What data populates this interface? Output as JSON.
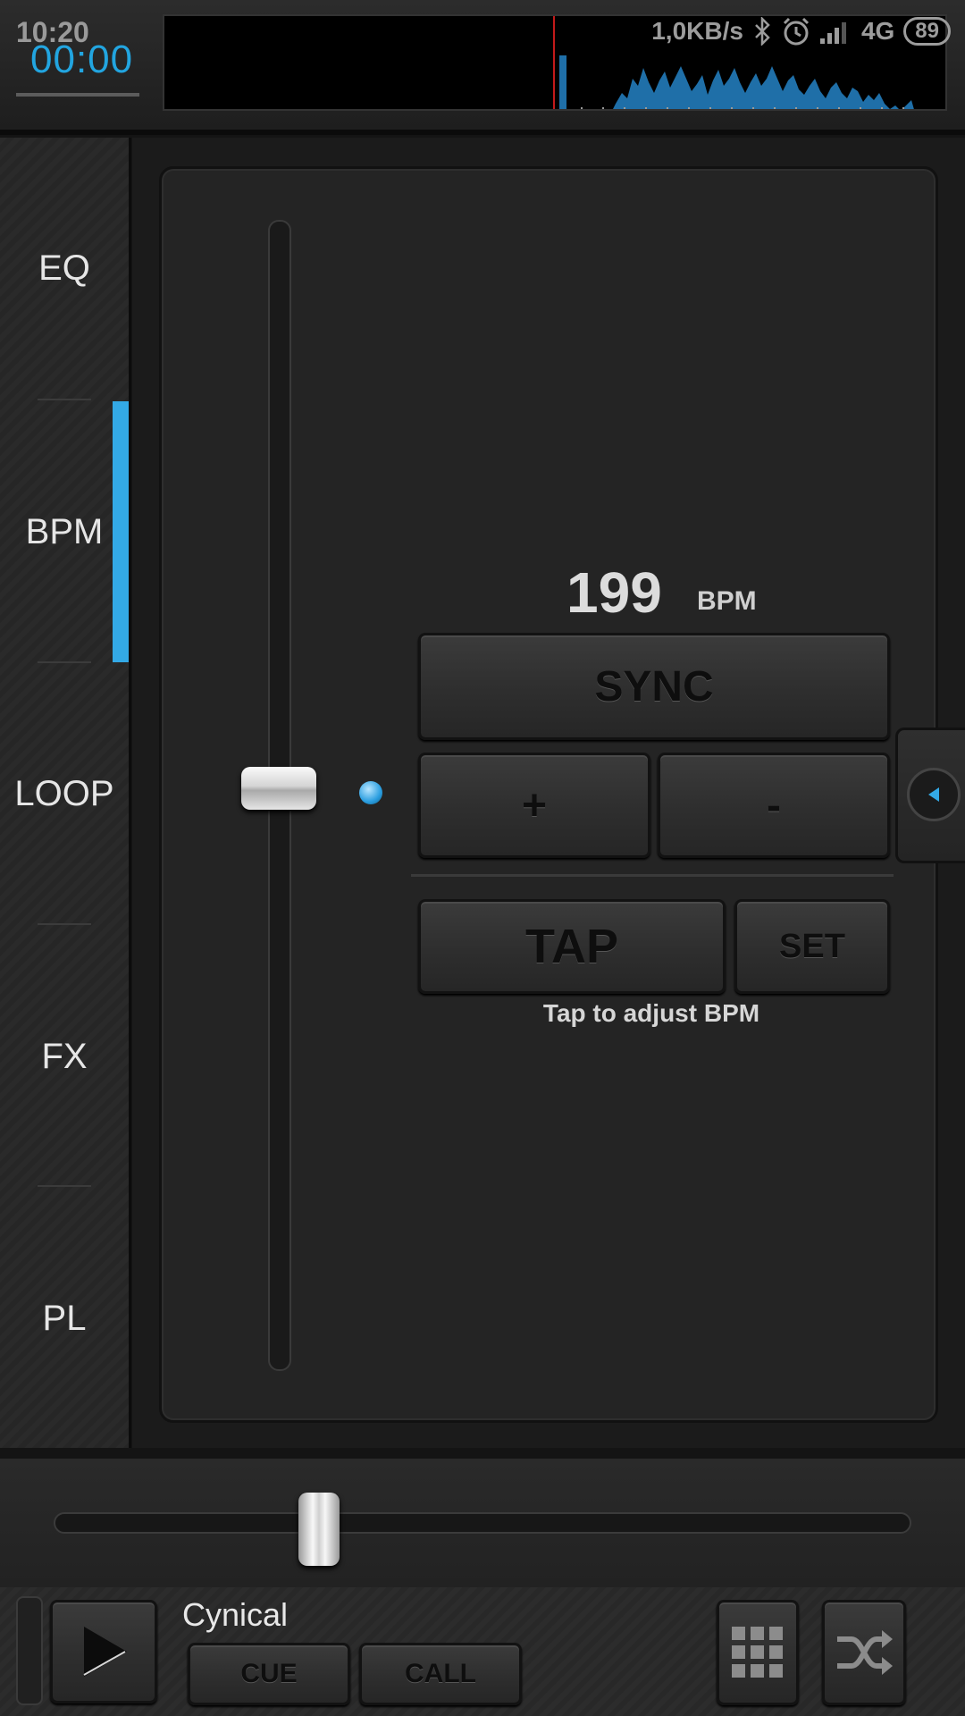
{
  "status_bar": {
    "time": "10:20",
    "network_speed": "1,0KB/s",
    "network_type": "4G",
    "battery": "89"
  },
  "deck_header": {
    "timer": "00:00"
  },
  "sidebar": {
    "tabs": [
      {
        "label": "EQ"
      },
      {
        "label": "BPM"
      },
      {
        "label": "LOOP"
      },
      {
        "label": "FX"
      },
      {
        "label": "PL"
      }
    ],
    "active": "BPM"
  },
  "bpm_panel": {
    "value": "199",
    "unit": "BPM",
    "sync_label": "SYNC",
    "plus_label": "+",
    "minus_label": "-",
    "tap_label": "TAP",
    "set_label": "SET",
    "hint": "Tap to adjust BPM"
  },
  "player": {
    "track_title": "Cynical",
    "cue_label": "CUE",
    "call_label": "CALL"
  },
  "colors": {
    "accent": "#33a9e6",
    "waveform": "#1f6fa8",
    "playhead": "#c21a1a"
  }
}
